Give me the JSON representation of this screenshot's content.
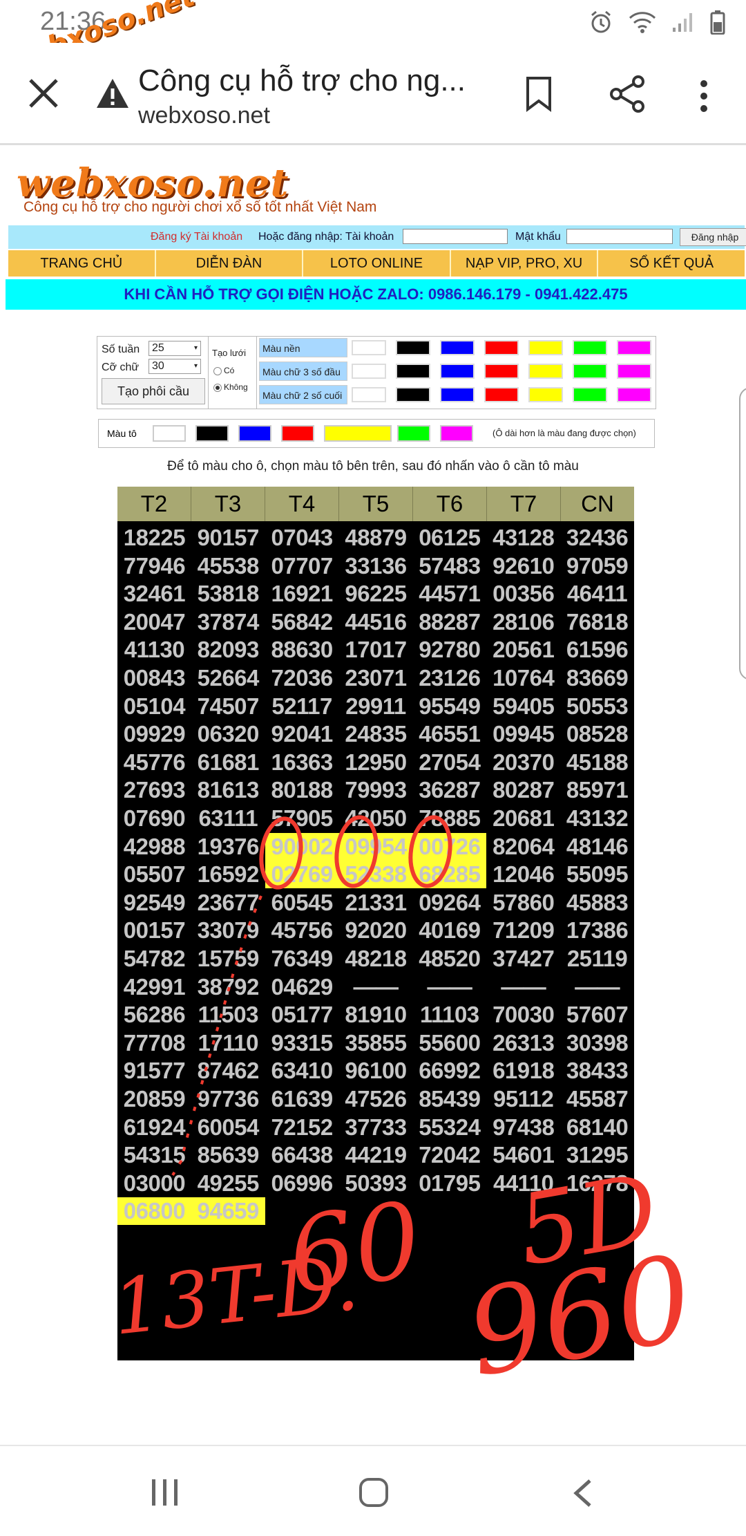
{
  "status": {
    "time": "21:36",
    "watermark": "webxoso.net"
  },
  "browser": {
    "title": "Công cụ hỗ trợ cho ng...",
    "url": "webxoso.net"
  },
  "site": {
    "logo": "webxoso.net",
    "tagline": "Công cụ hỗ trợ cho người chơi xổ số tốt nhất Việt Nam",
    "register": "Đăng ký Tài khoản",
    "login_label": "Hoặc đăng nhập: Tài khoản",
    "password_label": "Mật khẩu",
    "login_button": "Đăng nhập",
    "nav": [
      "TRANG CHỦ",
      "DIỄN ĐÀN",
      "LOTO ONLINE",
      "NẠP VIP, PRO, XU",
      "SỔ KẾT QUẢ"
    ],
    "hotline": "KHI CẦN HỖ TRỢ GỌI ĐIỆN HOẶC ZALO: 0986.146.179 - 0941.422.475"
  },
  "controls": {
    "weeks_label": "Số tuần",
    "weeks_value": "25",
    "size_label": "Cỡ chữ",
    "size_value": "30",
    "generate_button": "Tạo phôi cầu",
    "grid_label": "Tạo lưới",
    "grid_yes": "Có",
    "grid_no": "Không",
    "bg_label": "Màu nền",
    "first3_label": "Màu chữ 3 số đầu",
    "last2_label": "Màu chữ 2 số cuối",
    "swatches": [
      "#ffffff",
      "#000000",
      "#0000ff",
      "#ff0000",
      "#ffff00",
      "#00ff00",
      "#ff00ff"
    ],
    "paint_label": "Màu tô",
    "paint_note": "(Ô dài hơn là màu đang được chọn)",
    "instruction": "Để tô màu cho ô, chọn màu tô bên trên, sau đó nhấn vào ô cần tô màu"
  },
  "table": {
    "headers": [
      "T2",
      "T3",
      "T4",
      "T5",
      "T6",
      "T7",
      "CN"
    ],
    "rows": [
      [
        "18225",
        "90157",
        "07043",
        "48879",
        "06125",
        "43128",
        "32436"
      ],
      [
        "77946",
        "45538",
        "07707",
        "33136",
        "57483",
        "92610",
        "97059"
      ],
      [
        "32461",
        "53818",
        "16921",
        "96225",
        "44571",
        "00356",
        "46411"
      ],
      [
        "20047",
        "37874",
        "56842",
        "44516",
        "88287",
        "28106",
        "76818"
      ],
      [
        "41130",
        "82093",
        "88630",
        "17017",
        "92780",
        "20561",
        "61596"
      ],
      [
        "00843",
        "52664",
        "72036",
        "23071",
        "23126",
        "10764",
        "83669"
      ],
      [
        "05104",
        "74507",
        "52117",
        "29911",
        "95549",
        "59405",
        "50553"
      ],
      [
        "09929",
        "06320",
        "92041",
        "24835",
        "46551",
        "09945",
        "08528"
      ],
      [
        "45776",
        "61681",
        "16363",
        "12950",
        "27054",
        "20370",
        "45188"
      ],
      [
        "27693",
        "81613",
        "80188",
        "79993",
        "36287",
        "80287",
        "85971"
      ],
      [
        "07690",
        "63111",
        "57905",
        "42050",
        "78885",
        "20681",
        "43132"
      ],
      [
        "42988",
        "19376",
        "90002",
        "09954",
        "00726",
        "82064",
        "48146"
      ],
      [
        "05507",
        "16592",
        "02769",
        "52338",
        "68285",
        "12046",
        "55095"
      ],
      [
        "92549",
        "23677",
        "60545",
        "21331",
        "09264",
        "57860",
        "45883"
      ],
      [
        "00157",
        "33079",
        "45756",
        "92020",
        "40169",
        "71209",
        "17386"
      ],
      [
        "54782",
        "15759",
        "76349",
        "48218",
        "48520",
        "37427",
        "25119"
      ],
      [
        "42991",
        "38792",
        "04629",
        "——",
        "——",
        "——",
        "——"
      ],
      [
        "56286",
        "11503",
        "05177",
        "81910",
        "11103",
        "70030",
        "57607"
      ],
      [
        "77708",
        "17110",
        "93315",
        "35855",
        "55600",
        "26313",
        "30398"
      ],
      [
        "91577",
        "87462",
        "63410",
        "96100",
        "66992",
        "61918",
        "38433"
      ],
      [
        "20859",
        "97736",
        "61639",
        "47526",
        "85439",
        "95112",
        "45587"
      ],
      [
        "61924",
        "60054",
        "72152",
        "37733",
        "55324",
        "97438",
        "68140"
      ],
      [
        "54315",
        "85639",
        "66438",
        "44219",
        "72042",
        "54601",
        "31295"
      ],
      [
        "03000",
        "49255",
        "06996",
        "50393",
        "01795",
        "44110",
        "16278"
      ],
      [
        "06800",
        "94659",
        "",
        "",
        "",
        "",
        ""
      ]
    ],
    "highlighted": [
      [
        11,
        2
      ],
      [
        11,
        3
      ],
      [
        11,
        4
      ],
      [
        12,
        2
      ],
      [
        12,
        3
      ],
      [
        12,
        4
      ],
      [
        24,
        0
      ],
      [
        24,
        1
      ]
    ]
  },
  "handwriting": {
    "circled": "000",
    "left_note": "13T-D.",
    "mid_note": "60",
    "right_note_1": "5D",
    "right_note_2": "960"
  },
  "colors": {
    "ink": "#f03a2e",
    "highlight": "#ffff33",
    "header": "#a8a872",
    "nav": "#f6c24a",
    "hotline": "#00ffff"
  }
}
